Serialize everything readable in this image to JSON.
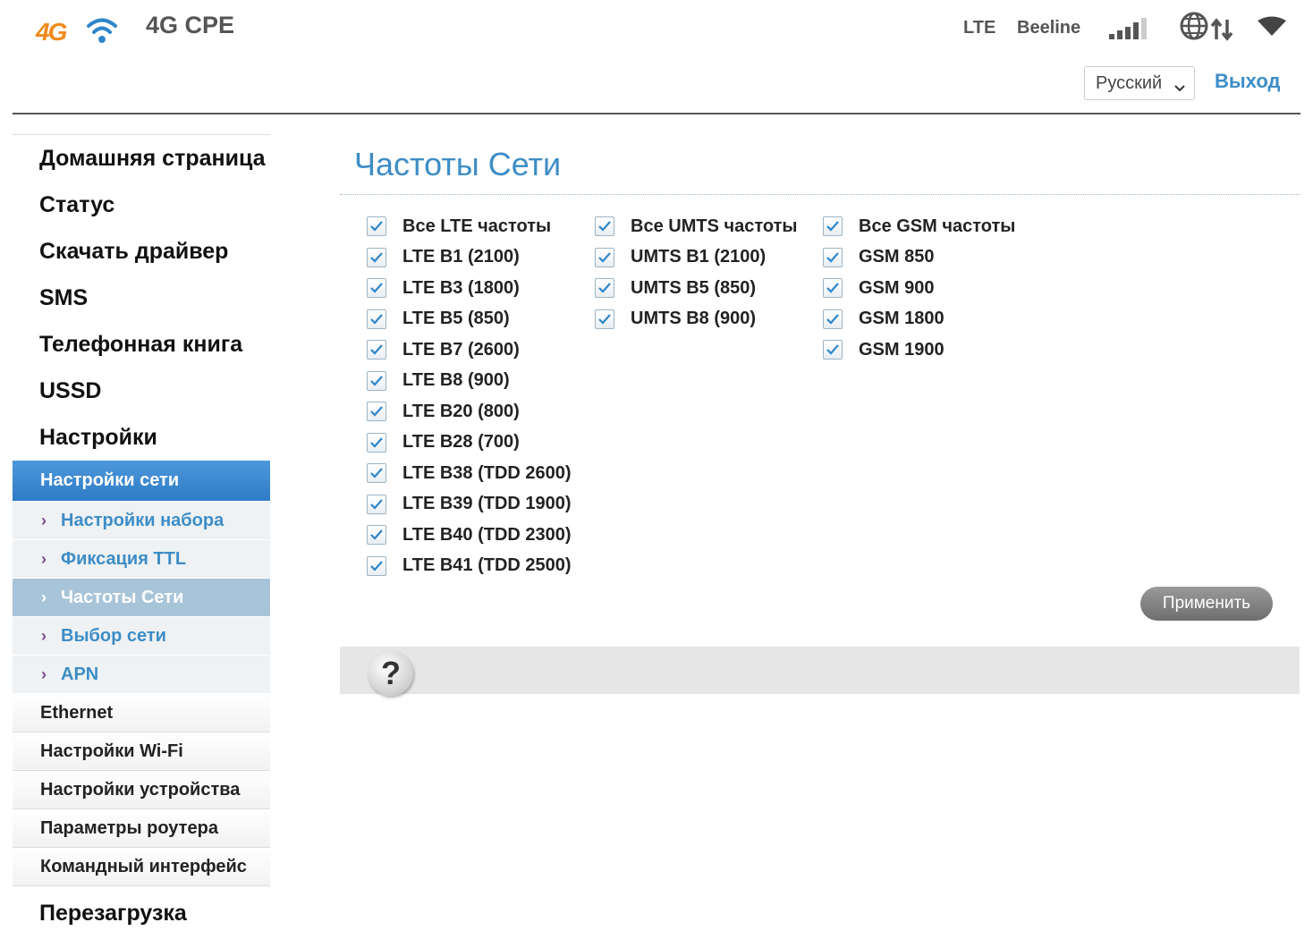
{
  "header": {
    "logo_text": "4G",
    "product_name": "4G CPE",
    "network_type": "LTE",
    "operator": "Beeline",
    "language": "Русский",
    "logout_label": "Выход"
  },
  "sidebar": {
    "items_top": [
      {
        "label": "Домашняя страница"
      },
      {
        "label": "Статус"
      },
      {
        "label": "Скачать драйвер"
      },
      {
        "label": "SMS"
      },
      {
        "label": "Телефонная книга"
      },
      {
        "label": "USSD"
      },
      {
        "label": "Настройки"
      }
    ],
    "active_section": "Настройки сети",
    "subitems": [
      {
        "label": "Настройки набора"
      },
      {
        "label": "Фиксация TTL"
      },
      {
        "label": "Частоты Сети"
      },
      {
        "label": "Выбор сети"
      },
      {
        "label": "APN"
      }
    ],
    "items_settings": [
      {
        "label": "Ethernet"
      },
      {
        "label": "Настройки Wi-Fi"
      },
      {
        "label": "Настройки устройства"
      },
      {
        "label": "Параметры роутера"
      },
      {
        "label": "Командный интерфейс"
      }
    ],
    "bottom": "Перезагрузка"
  },
  "main": {
    "title": "Частоты Сети",
    "lte": [
      {
        "label": "Все LTE частоты",
        "checked": true
      },
      {
        "label": "LTE B1 (2100)",
        "checked": true
      },
      {
        "label": "LTE B3 (1800)",
        "checked": true
      },
      {
        "label": "LTE B5 (850)",
        "checked": true
      },
      {
        "label": "LTE B7 (2600)",
        "checked": true
      },
      {
        "label": "LTE B8 (900)",
        "checked": true
      },
      {
        "label": "LTE B20 (800)",
        "checked": true
      },
      {
        "label": "LTE B28 (700)",
        "checked": true
      },
      {
        "label": "LTE B38 (TDD 2600)",
        "checked": true
      },
      {
        "label": "LTE B39 (TDD 1900)",
        "checked": true
      },
      {
        "label": "LTE B40 (TDD 2300)",
        "checked": true
      },
      {
        "label": "LTE B41 (TDD 2500)",
        "checked": true
      }
    ],
    "umts": [
      {
        "label": "Все UMTS частоты",
        "checked": true
      },
      {
        "label": "UMTS B1 (2100)",
        "checked": true
      },
      {
        "label": "UMTS B5 (850)",
        "checked": true
      },
      {
        "label": "UMTS B8 (900)",
        "checked": true
      }
    ],
    "gsm": [
      {
        "label": "Все GSM частоты",
        "checked": true
      },
      {
        "label": "GSM 850",
        "checked": true
      },
      {
        "label": "GSM 900",
        "checked": true
      },
      {
        "label": "GSM 1800",
        "checked": true
      },
      {
        "label": "GSM 1900",
        "checked": true
      }
    ],
    "apply_label": "Применить",
    "help_symbol": "?"
  },
  "colors": {
    "accent": "#3d8dc6",
    "logo_orange": "#f08a1c",
    "active_nav": "#2f7cc6",
    "selected_sub": "#a8c4d8"
  }
}
